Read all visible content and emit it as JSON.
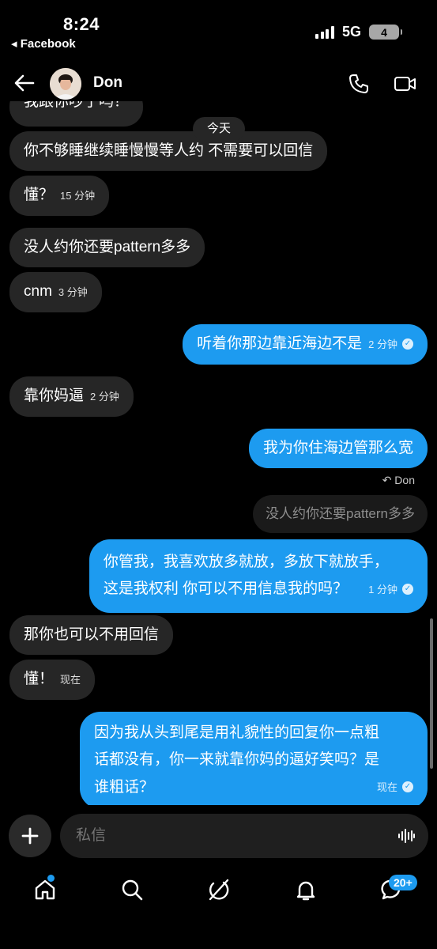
{
  "status_bar": {
    "time": "8:24",
    "back_app": "◂ Facebook",
    "network": "5G",
    "battery": "4"
  },
  "header": {
    "contact_name": "Don",
    "icons": [
      "back-arrow-icon",
      "phone-icon",
      "video-camera-icon"
    ]
  },
  "chat": {
    "day_separator": "今天",
    "top_partial_message": "我跟你吵了吗？",
    "messages": [
      {
        "text": "你不够睡继续睡慢慢等人约 不需要可以回信",
        "time": ""
      },
      {
        "text": "懂？",
        "time": "15 分钟"
      },
      {
        "text": "没人约你还要pattern多多",
        "time": ""
      },
      {
        "text": "cnm",
        "time": "3 分钟"
      },
      {
        "text": "听着你那边靠近海边不是",
        "time": "2 分钟"
      },
      {
        "text": "靠你妈逼",
        "time": "2 分钟"
      },
      {
        "text": "我为你住海边管那么宽",
        "time": ""
      },
      {
        "text": "你管我，我喜欢放多就放，多放下就放手，",
        "line2": "这是我权利 你可以不用信息我的吗？",
        "time": "1 分钟"
      },
      {
        "text": "那你也可以不用回信",
        "time": ""
      },
      {
        "text": "懂！",
        "time": "现在"
      },
      {
        "text": "因为我从头到尾是用礼貌性的回复你一点粗",
        "line2": "话都没有，你一来就靠你妈的逼好笑吗？是",
        "line3": "谁粗话？",
        "time": "现在"
      }
    ],
    "reply_label": "↶ Don",
    "quoted_message": "没人约你还要pattern多多"
  },
  "composer": {
    "placeholder": "私信"
  },
  "tab_bar": {
    "icons": [
      "home-icon",
      "search-icon",
      "grok-icon",
      "bell-icon",
      "messages-icon"
    ],
    "messages_badge": "20+"
  },
  "colors": {
    "background": "#000000",
    "incoming_bubble": "#262626",
    "outgoing_bubble": "#1d9bf0",
    "accent": "#1d9bf0"
  }
}
